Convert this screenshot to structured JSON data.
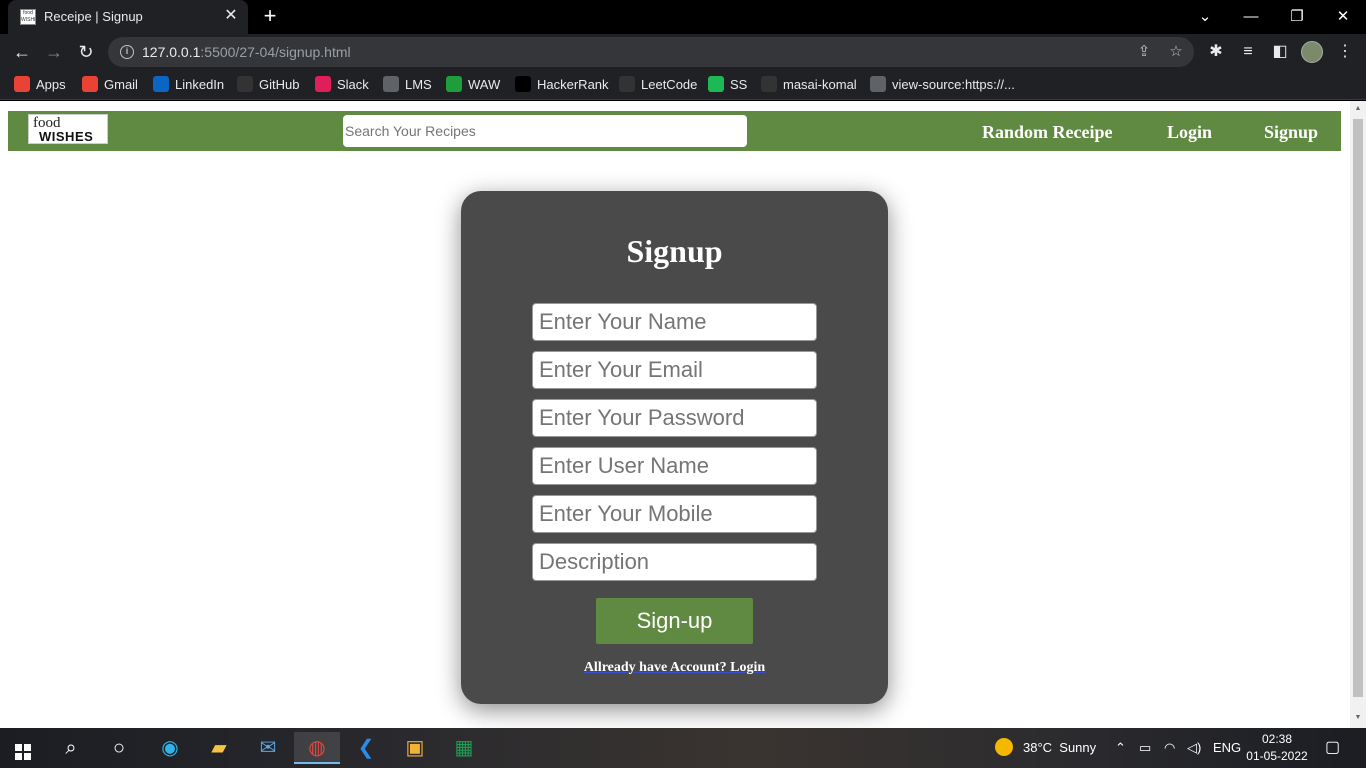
{
  "browser": {
    "tab": {
      "favicon_text": "food WISHES",
      "title": "Receipe | Signup",
      "close": "✕"
    },
    "new_tab": "+",
    "window": {
      "minimize": "—",
      "restore": "❐",
      "close": "✕",
      "tab_search": "⌄"
    },
    "nav": {
      "back": "←",
      "forward": "→",
      "reload": "↻"
    },
    "address": {
      "host": "127.0.0.1",
      "path": ":5500/27-04/signup.html"
    },
    "bookmarks": [
      {
        "label": "Apps",
        "icon": "apps-grid-icon",
        "color": "#ea4335"
      },
      {
        "label": "Gmail",
        "icon": "gmail-icon",
        "color": "#ea4335"
      },
      {
        "label": "LinkedIn",
        "icon": "linkedin-icon",
        "color": "#0a66c2"
      },
      {
        "label": "GitHub",
        "icon": "github-icon",
        "color": "#333333"
      },
      {
        "label": "Slack",
        "icon": "slack-icon",
        "color": "#e01e5a"
      },
      {
        "label": "LMS",
        "icon": "globe-icon",
        "color": "#5f6368"
      },
      {
        "label": "WAW",
        "icon": "waw-icon",
        "color": "#1e9e3a"
      },
      {
        "label": "HackerRank",
        "icon": "hackerrank-icon",
        "color": "#000000"
      },
      {
        "label": "LeetCode",
        "icon": "leetcode-icon",
        "color": "#333333"
      },
      {
        "label": "SS",
        "icon": "spotify-icon",
        "color": "#1db954"
      },
      {
        "label": "masai-komal",
        "icon": "github-icon",
        "color": "#333333"
      },
      {
        "label": "view-source:https://...",
        "icon": "globe-icon",
        "color": "#5f6368"
      }
    ]
  },
  "site": {
    "logo": {
      "top": "food",
      "bottom": "WISHES"
    },
    "search_placeholder": "Search Your Recipes",
    "nav_links": [
      "Random Receipe",
      "Login",
      "Signup"
    ],
    "accent_color": "#608a41",
    "card_color": "#4a4a4a"
  },
  "signup": {
    "title": "Signup",
    "fields": [
      "Enter Your Name",
      "Enter Your Email",
      "Enter Your Password",
      "Enter User Name",
      "Enter Your Mobile",
      "Description"
    ],
    "submit_label": "Sign-up",
    "login_prompt": "Allready have Account? Login"
  },
  "taskbar": {
    "weather": {
      "temp": "38°C",
      "condition": "Sunny"
    },
    "language": "ENG",
    "time": "02:38",
    "date": "01-05-2022"
  }
}
